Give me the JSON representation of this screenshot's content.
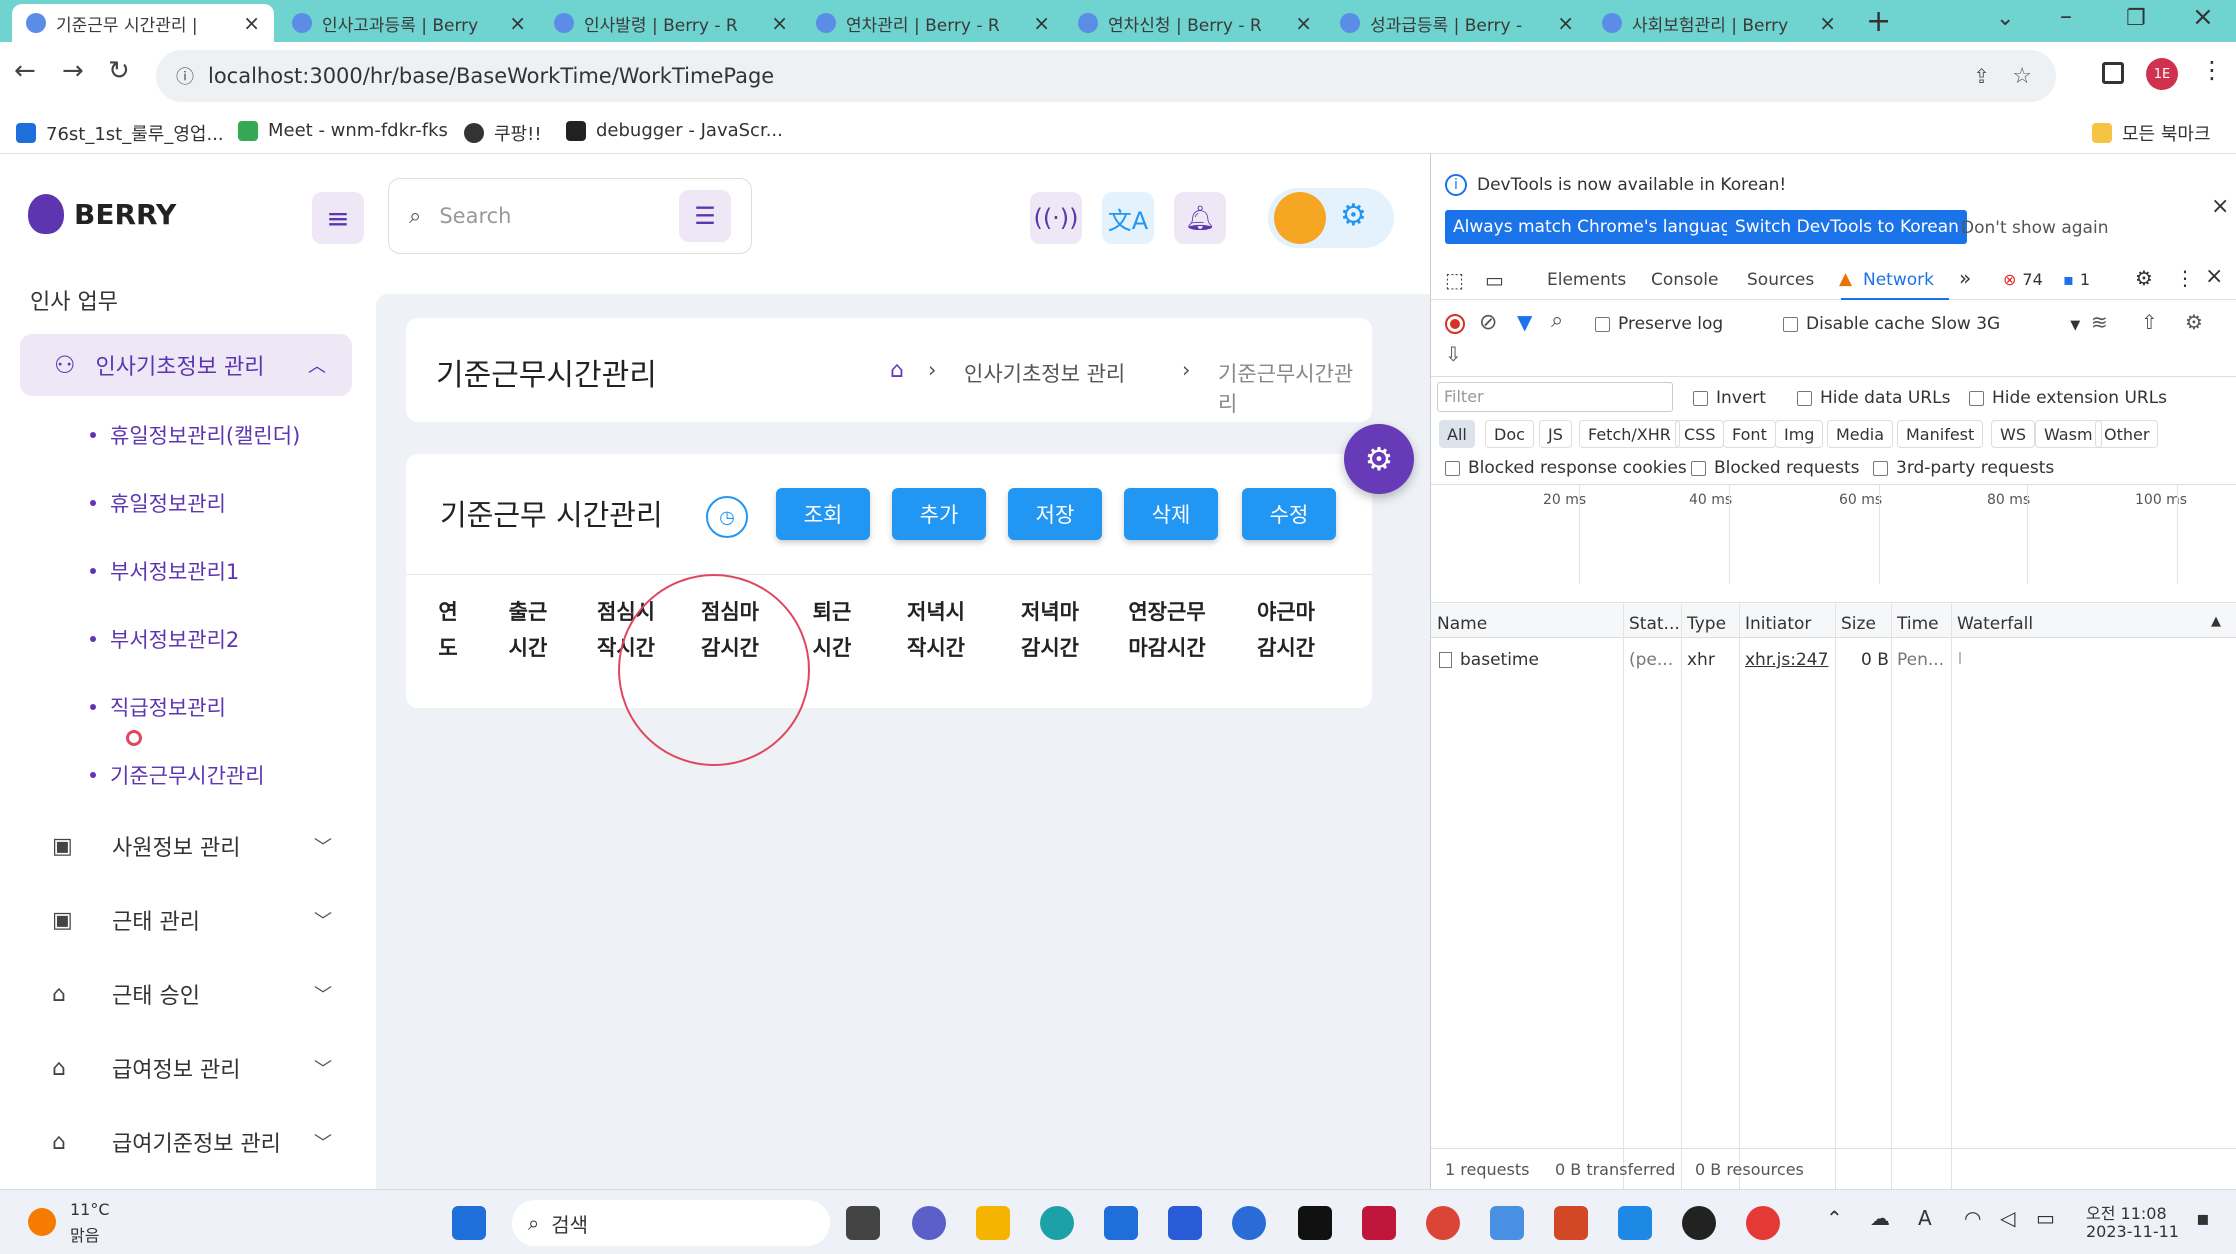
{
  "browser": {
    "tabs": [
      {
        "label": "기준근무 시간관리 |",
        "active": true
      },
      {
        "label": "인사고과등록 | Berry"
      },
      {
        "label": "인사발령 | Berry - R"
      },
      {
        "label": "연차관리 | Berry - R"
      },
      {
        "label": "연차신청 | Berry - R"
      },
      {
        "label": "성과급등록 | Berry -"
      },
      {
        "label": "사회보험관리 | Berry"
      }
    ],
    "url": "localhost:3000/hr/base/BaseWorkTime/WorkTimePage",
    "profile_initial": "1E",
    "bookmarks": [
      {
        "label": "76st_1st_룰루_영업..."
      },
      {
        "label": "Meet - wnm-fdkr-fks"
      },
      {
        "label": "쿠팡!!"
      },
      {
        "label": "debugger - JavaScr..."
      }
    ],
    "all_bookmarks": "모든 북마크"
  },
  "app": {
    "brand": "BERRY",
    "search_placeholder": "Search",
    "sidebar": {
      "section_title": "인사 업무",
      "active_menu": "인사기초정보 관리",
      "sub_items": [
        "휴일정보관리(캘린더)",
        "휴일정보관리",
        "부서정보관리1",
        "부서정보관리2",
        "직급정보관리",
        "기준근무시간관리"
      ],
      "menus": [
        "사원정보 관리",
        "근태 관리",
        "근태 승인",
        "급여정보 관리",
        "급여기준정보 관리"
      ]
    },
    "page_title": "기준근무시간관리",
    "breadcrumb": [
      "인사기초정보 관리",
      "기준근무시간관리"
    ],
    "card_title": "기준근무 시간관리",
    "buttons": [
      "조회",
      "추가",
      "저장",
      "삭제",
      "수정"
    ],
    "columns": [
      "연\n도",
      "출근\n시간",
      "점심시\n작시간",
      "점심마\n감시간",
      "퇴근\n시간",
      "저녁시\n작시간",
      "저녁마\n감시간",
      "연장근무\n마감시간",
      "야근마\n감시간"
    ]
  },
  "devtools": {
    "notice": "DevTools is now available in Korean!",
    "btn_match": "Always match Chrome's language",
    "btn_switch": "Switch DevTools to Korean",
    "dont_show": "Don't show again",
    "tabs": [
      "Elements",
      "Console",
      "Sources",
      "Network"
    ],
    "error_count": "74",
    "message_count": "1",
    "preserve_log": "Preserve log",
    "disable_cache": "Disable cache",
    "throttle": "Slow 3G",
    "filter_placeholder": "Filter",
    "invert": "Invert",
    "hide_data_urls": "Hide data URLs",
    "hide_ext_urls": "Hide extension URLs",
    "type_filters": [
      "All",
      "Doc",
      "JS",
      "Fetch/XHR",
      "CSS",
      "Font",
      "Img",
      "Media",
      "Manifest",
      "WS",
      "Wasm",
      "Other"
    ],
    "blocked_cookies": "Blocked response cookies",
    "blocked_requests": "Blocked requests",
    "third_party": "3rd-party requests",
    "ruler": [
      "20 ms",
      "40 ms",
      "60 ms",
      "80 ms",
      "100 ms"
    ],
    "columns": [
      "Name",
      "Stat...",
      "Type",
      "Initiator",
      "Size",
      "Time",
      "Waterfall"
    ],
    "rows": [
      {
        "name": "basetime",
        "status": "(pe...",
        "type": "xhr",
        "initiator": "xhr.js:247",
        "size": "0 B",
        "time": "Pen..."
      }
    ],
    "footer": [
      "1 requests",
      "0 B transferred",
      "0 B resources"
    ]
  },
  "taskbar": {
    "weather_temp": "11°C",
    "weather_desc": "맑음",
    "search_label": "검색",
    "time": "오전 11:08",
    "date": "2023-11-11"
  }
}
